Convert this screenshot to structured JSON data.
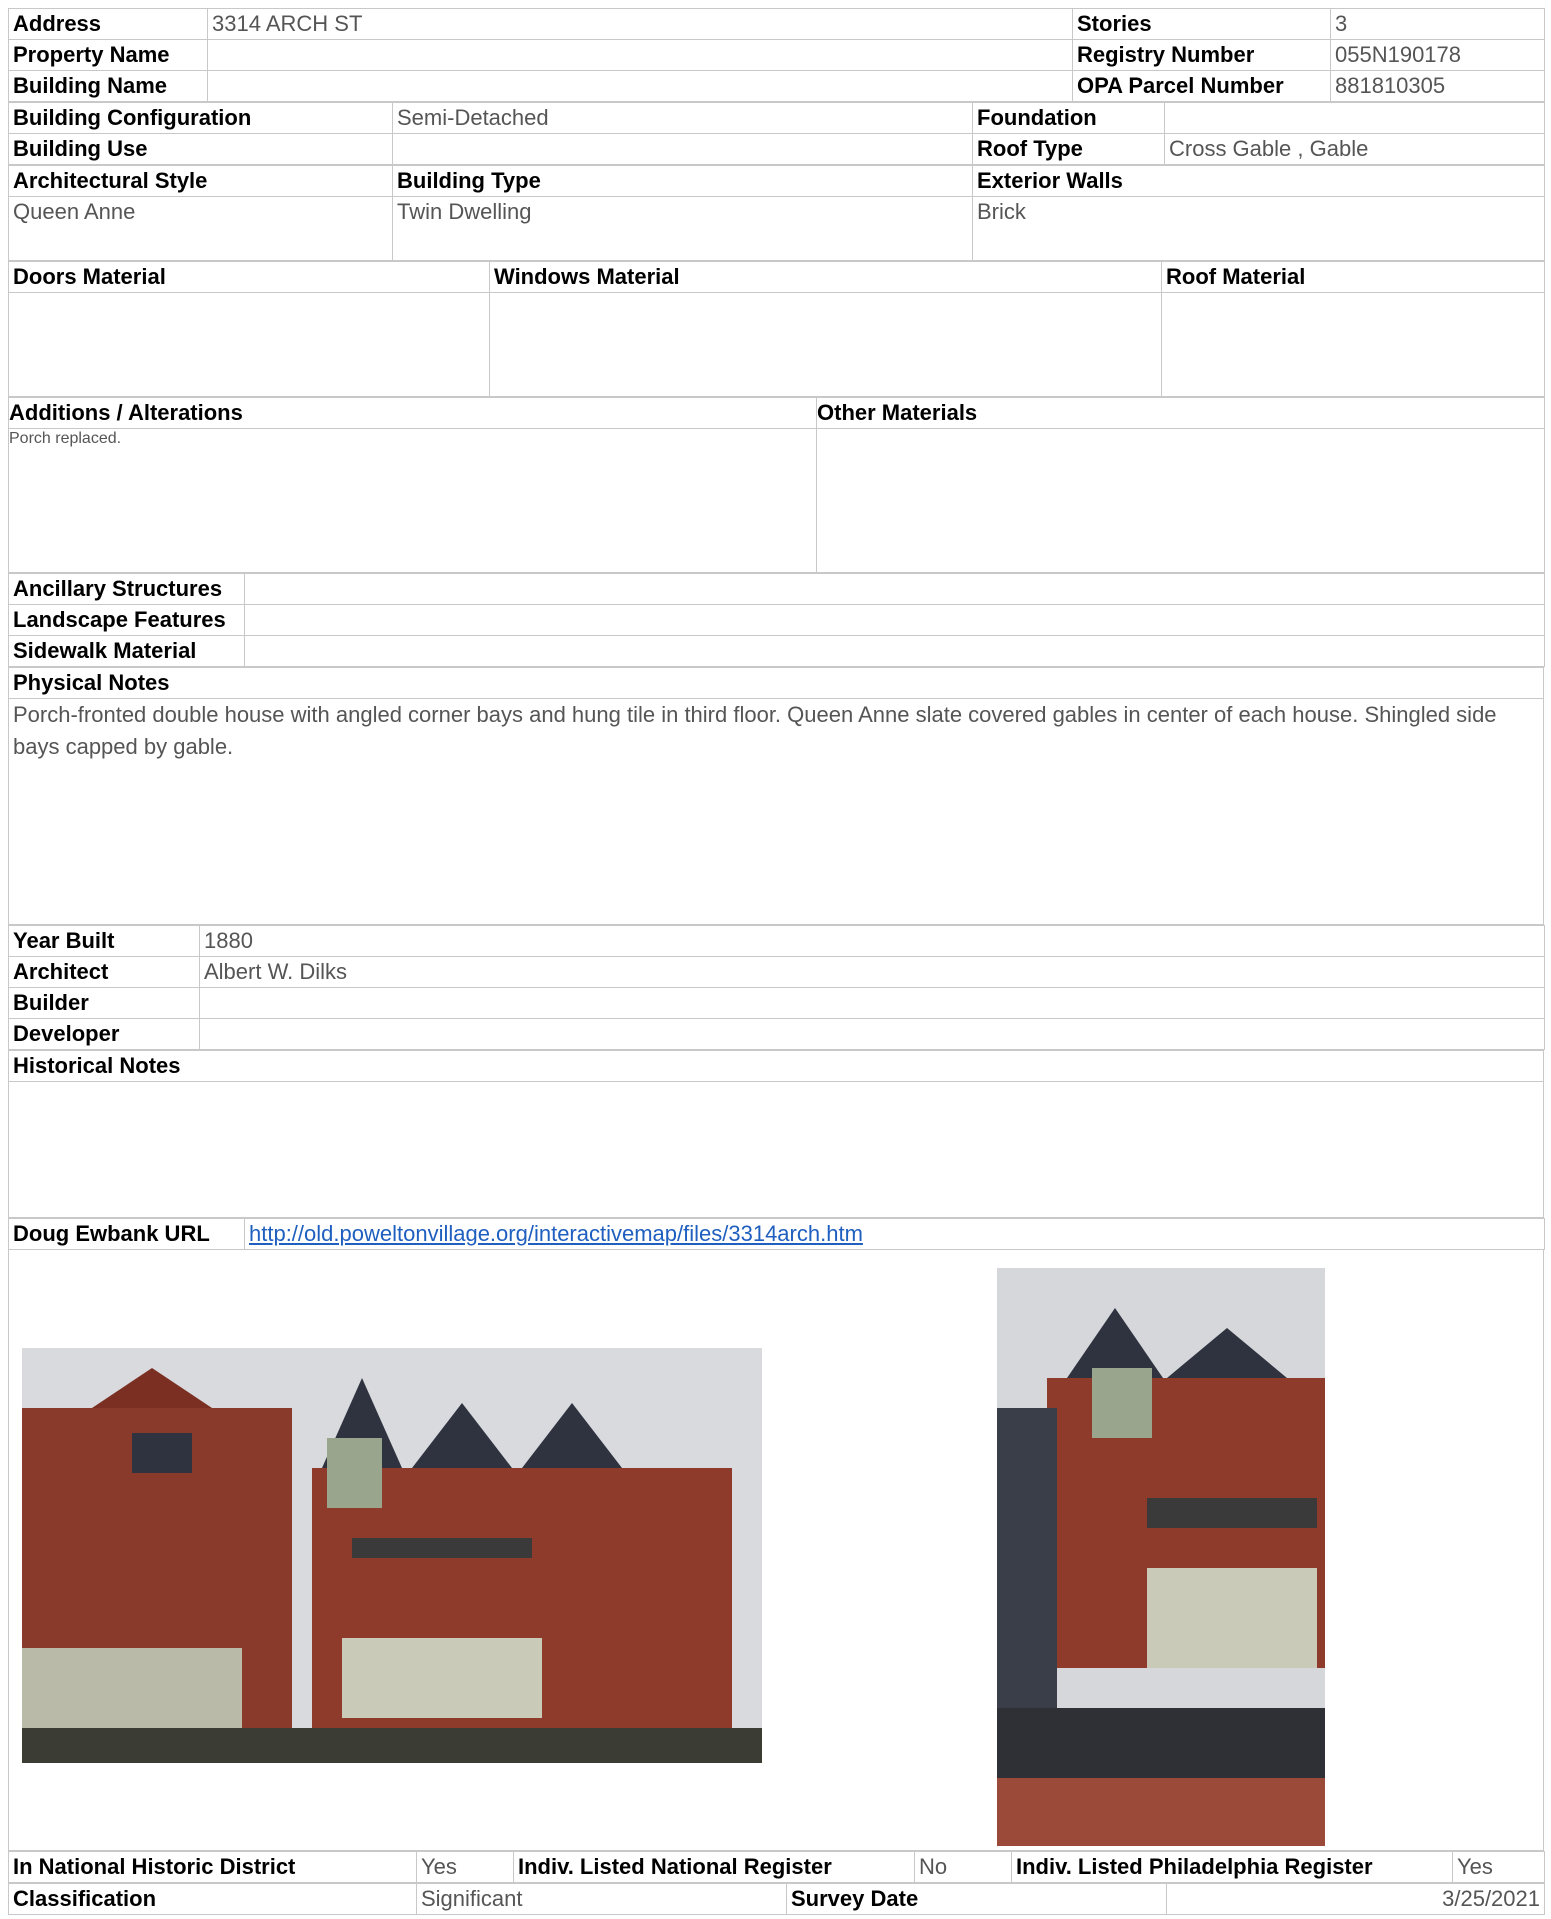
{
  "header": {
    "address_label": "Address",
    "address": "3314 ARCH ST",
    "stories_label": "Stories",
    "stories": "3",
    "property_name_label": "Property Name",
    "property_name": "",
    "registry_label": "Registry Number",
    "registry": "055N190178",
    "building_name_label": "Building Name",
    "building_name": "",
    "opa_label": "OPA Parcel Number",
    "opa": "881810305"
  },
  "config": {
    "configuration_label": "Building Configuration",
    "configuration": "Semi-Detached",
    "foundation_label": "Foundation",
    "foundation": "",
    "use_label": "Building Use",
    "use": "",
    "roof_type_label": "Roof Type",
    "roof_type": "Cross Gable , Gable",
    "style_label": "Architectural Style",
    "style": "Queen Anne",
    "type_label": "Building Type",
    "type": "Twin Dwelling",
    "walls_label": "Exterior Walls",
    "walls": "Brick"
  },
  "materials": {
    "doors_label": "Doors Material",
    "doors": "",
    "windows_label": "Windows Material",
    "windows": "",
    "roof_label": "Roof Material",
    "roof": ""
  },
  "alterations": {
    "additions_label": "Additions / Alterations",
    "additions": "Porch replaced.",
    "other_label": "Other Materials",
    "other": ""
  },
  "site": {
    "ancillary_label": "Ancillary Structures",
    "ancillary": "",
    "landscape_label": "Landscape Features",
    "landscape": "",
    "sidewalk_label": "Sidewalk Material",
    "sidewalk": ""
  },
  "physical": {
    "label": "Physical Notes",
    "text": "Porch-fronted double house with angled corner bays and hung tile in third floor. Queen Anne slate covered gables in center of each house. Shingled side bays capped by gable."
  },
  "history": {
    "year_label": "Year Built",
    "year": "1880",
    "architect_label": "Architect",
    "architect": "Albert W. Dilks",
    "builder_label": "Builder",
    "builder": "",
    "developer_label": "Developer",
    "developer": "",
    "notes_label": "Historical Notes",
    "notes": ""
  },
  "url": {
    "label": "Doug Ewbank URL",
    "href": "http://old.poweltonvillage.org/interactivemap/files/3314arch.htm"
  },
  "status": {
    "district_label": "In National Historic District",
    "district": "Yes",
    "national_label": "Indiv. Listed National Register",
    "national": "No",
    "phila_label": "Indiv. Listed Philadelphia Register",
    "phila": "Yes",
    "classification_label": "Classification",
    "classification": "Significant",
    "survey_label": "Survey Date",
    "survey": "3/25/2021"
  },
  "colors": {
    "border": "#c8c8c8",
    "value": "#555555",
    "link": "#1f5fbf",
    "brick": "#8a3a2a",
    "roof": "#2f3340",
    "trim": "#9aa58e"
  }
}
